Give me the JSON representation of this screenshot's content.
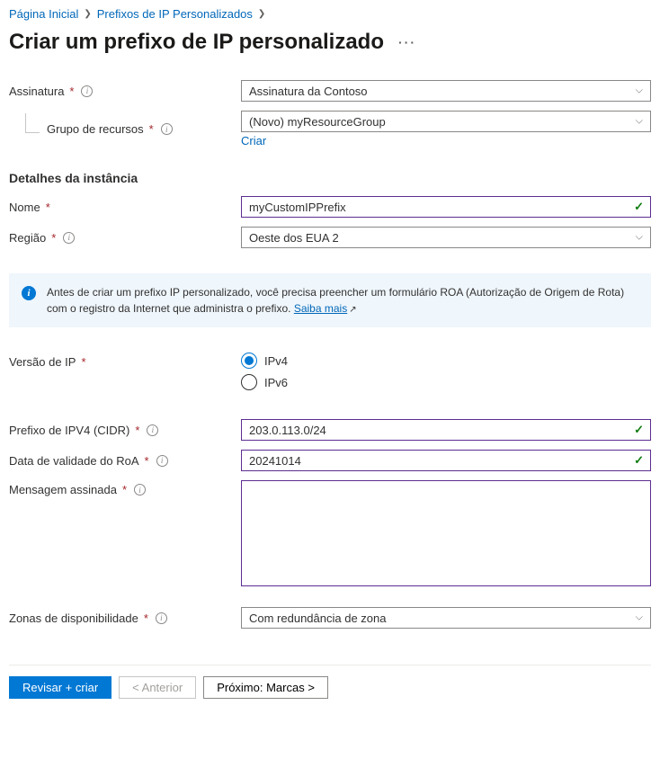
{
  "breadcrumb": {
    "home": "Página Inicial",
    "prefixes": "Prefixos de IP Personalizados"
  },
  "title": "Criar um prefixo de IP personalizado",
  "labels": {
    "subscription": "Assinatura",
    "resource_group": "Grupo de recursos",
    "instance_details": "Detalhes da instância",
    "name": "Nome",
    "region": "Região",
    "ip_version": "Versão de IP",
    "ipv4_cidr": "Prefixo de IPV4 (CIDR)",
    "roa_expiry": "Data de validade do RoA",
    "signed_message": "Mensagem assinada",
    "availability_zones": "Zonas de disponibilidade"
  },
  "values": {
    "subscription": "Assinatura da Contoso",
    "resource_group": "(Novo) myResourceGroup",
    "create_new_link": "Criar",
    "name": "myCustomIPPrefix",
    "region": "Oeste dos EUA 2",
    "ipv4_option": "IPv4",
    "ipv6_option": "IPv6",
    "cidr": "203.0.113.0/24",
    "roa_expiry": "20241014",
    "signed_message": "",
    "availability_zone": "Com redundância de zona"
  },
  "info": {
    "text": "Antes de criar um prefixo IP personalizado, você precisa preencher um formulário ROA (Autorização de Origem de Rota) com o registro da Internet que administra o prefixo.",
    "learn_more": "Saiba mais"
  },
  "footer": {
    "review_create": "Revisar + criar",
    "previous": "< Anterior",
    "next": "Próximo: Marcas >"
  }
}
